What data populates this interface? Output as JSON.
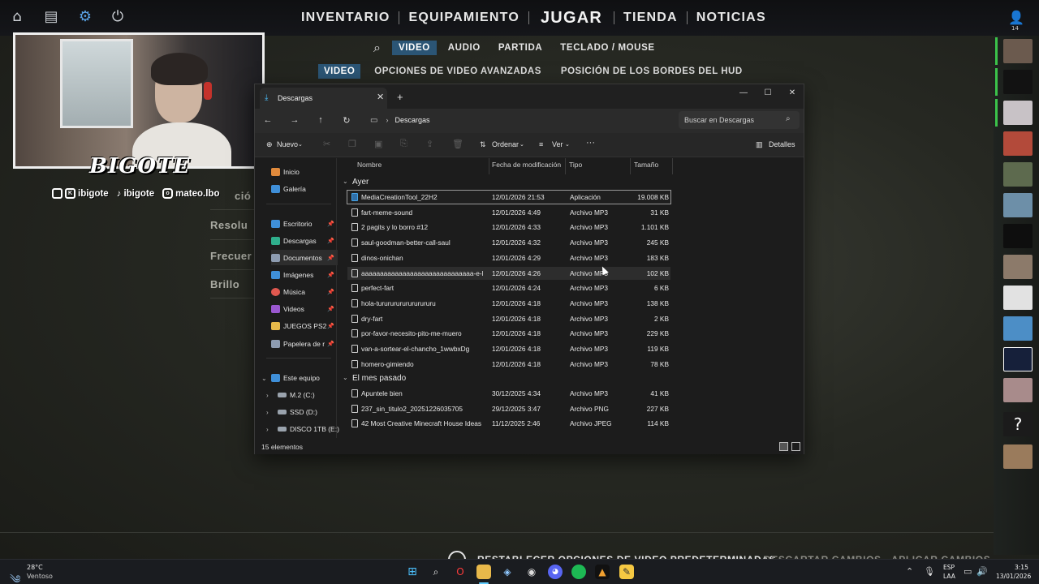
{
  "game": {
    "main_nav": [
      "INVENTARIO",
      "EQUIPAMIENTO",
      "JUGAR",
      "TIENDA",
      "NOTICIAS"
    ],
    "profile_count": "14",
    "settings_tabs": [
      "VIDEO",
      "AUDIO",
      "PARTIDA",
      "TECLADO / MOUSE"
    ],
    "sub_tabs": [
      "VIDEO",
      "OPCIONES DE VIDEO AVANZADAS",
      "POSICIÓN DE LOS BORDES DEL HUD"
    ],
    "left_settings": [
      "ció",
      "Resolu",
      "Frecuer",
      "Brillo"
    ],
    "bottom_bar": {
      "reset": "RESTABLECER OPCIONES DE VIDEO PREDETERMINADAS",
      "discard": "DESCARTAR CAMBIOS",
      "apply": "APLICAR CAMBIOS"
    }
  },
  "overlay": {
    "brand": "BIGOTE",
    "socials": [
      "ibigote",
      "ibigote",
      "mateo.lbo"
    ]
  },
  "explorer": {
    "tab_title": "Descargas",
    "address": "Descargas",
    "search_placeholder": "Buscar en Descargas",
    "toolbar": {
      "new": "Nuevo",
      "sort": "Ordenar",
      "view": "Ver",
      "more": "···",
      "details": "Detalles"
    },
    "nav": {
      "quick": [
        {
          "label": "Inicio",
          "icon": "home-icon",
          "color": "#e08a3c"
        },
        {
          "label": "Galería",
          "icon": "gallery-icon",
          "color": "#3f8fd8"
        }
      ],
      "pinned": [
        {
          "label": "Escritorio",
          "icon": "desktop-icon",
          "color": "#3f8fd8"
        },
        {
          "label": "Descargas",
          "icon": "download-icon",
          "color": "#2fae8c"
        },
        {
          "label": "Documentos",
          "icon": "documents-icon",
          "color": "#8d9bb0"
        },
        {
          "label": "Imágenes",
          "icon": "images-icon",
          "color": "#3f8fd8"
        },
        {
          "label": "Música",
          "icon": "music-icon",
          "color": "#e0584f"
        },
        {
          "label": "Videos",
          "icon": "videos-icon",
          "color": "#9a58d0"
        },
        {
          "label": "JUEGOS PS2",
          "icon": "folder-icon",
          "color": "#e6b94a"
        },
        {
          "label": "Papelera de r",
          "icon": "recycle-bin-icon",
          "color": "#8d9bb0"
        }
      ],
      "this_pc": "Este equipo",
      "drives": [
        "M.2 (C:)",
        "SSD (D:)",
        "DISCO 1TB (E:)"
      ]
    },
    "columns": [
      "Nombre",
      "Fecha de modificación",
      "Tipo",
      "Tamaño"
    ],
    "groups": [
      {
        "title": "Ayer",
        "files": [
          {
            "name": "MediaCreationTool_22H2",
            "date": "12/01/2026 21:53",
            "type": "Aplicación",
            "size": "19.008 KB"
          },
          {
            "name": "fart-meme-sound",
            "date": "12/01/2026 4:49",
            "type": "Archivo MP3",
            "size": "31 KB"
          },
          {
            "name": "2 pagits y lo borro #12",
            "date": "12/01/2026 4:33",
            "type": "Archivo MP3",
            "size": "1.101 KB"
          },
          {
            "name": "saul-goodman-better-call-saul",
            "date": "12/01/2026 4:32",
            "type": "Archivo MP3",
            "size": "245 KB"
          },
          {
            "name": "dinos-onichan",
            "date": "12/01/2026 4:29",
            "type": "Archivo MP3",
            "size": "183 KB"
          },
          {
            "name": "aaaaaaaaaaaaaaaaaaaaaaaaaaaaaa-e-l...",
            "date": "12/01/2026 4:26",
            "type": "Archivo MP3",
            "size": "102 KB"
          },
          {
            "name": "perfect-fart",
            "date": "12/01/2026 4:24",
            "type": "Archivo MP3",
            "size": "6 KB"
          },
          {
            "name": "hola-turururururururururu",
            "date": "12/01/2026 4:18",
            "type": "Archivo MP3",
            "size": "138 KB"
          },
          {
            "name": "dry-fart",
            "date": "12/01/2026 4:18",
            "type": "Archivo MP3",
            "size": "2 KB"
          },
          {
            "name": "por-favor-necesito-pito-me-muero",
            "date": "12/01/2026 4:18",
            "type": "Archivo MP3",
            "size": "229 KB"
          },
          {
            "name": "van-a-sortear-el-chancho_1wwbxDg",
            "date": "12/01/2026 4:18",
            "type": "Archivo MP3",
            "size": "119 KB"
          },
          {
            "name": "homero-gimiendo",
            "date": "12/01/2026 4:18",
            "type": "Archivo MP3",
            "size": "78 KB"
          }
        ]
      },
      {
        "title": "El mes pasado",
        "files": [
          {
            "name": "Apuntele bien",
            "date": "30/12/2025 4:34",
            "type": "Archivo MP3",
            "size": "41 KB"
          },
          {
            "name": "237_sin_titulo2_20251226035705",
            "date": "29/12/2025 3:47",
            "type": "Archivo PNG",
            "size": "227 KB"
          },
          {
            "name": "42 Most Creative Minecraft House Ideas t...",
            "date": "11/12/2025 2:46",
            "type": "Archivo JPEG",
            "size": "114 KB"
          }
        ]
      }
    ],
    "status": "15 elementos"
  },
  "taskbar": {
    "weather_temp": "28°C",
    "weather_desc": "Ventoso",
    "lang_1": "ESP",
    "lang_2": "LAA",
    "time": "3:15",
    "date": "13/01/2026"
  }
}
